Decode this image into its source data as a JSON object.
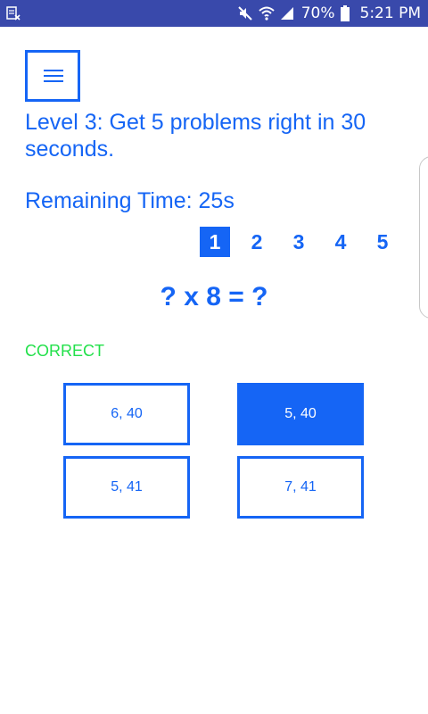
{
  "status_bar": {
    "left_icon": "screenshot-notification-icon",
    "icons": [
      "mute-icon",
      "wifi-icon",
      "signal-icon"
    ],
    "battery": "70%",
    "battery_icon": "battery-icon",
    "time": "5:21 PM",
    "background": "#3949ab"
  },
  "menu": {
    "icon": "hamburger-menu-icon"
  },
  "level": {
    "text": "Level 3: Get 5 problems right in 30 seconds."
  },
  "timer": {
    "text": "Remaining Time: 25s"
  },
  "progress": {
    "steps": [
      "1",
      "2",
      "3",
      "4",
      "5"
    ],
    "current": "1"
  },
  "problem": {
    "text": "? x 8 = ?"
  },
  "feedback": {
    "text": "CORRECT",
    "color": "#22e04a"
  },
  "answers": [
    {
      "label": "6, 40",
      "selected": false
    },
    {
      "label": "5, 40",
      "selected": true
    },
    {
      "label": "5, 41",
      "selected": false
    },
    {
      "label": "7, 41",
      "selected": false
    }
  ],
  "colors": {
    "accent": "#1565f5",
    "background": "#ffffff"
  }
}
